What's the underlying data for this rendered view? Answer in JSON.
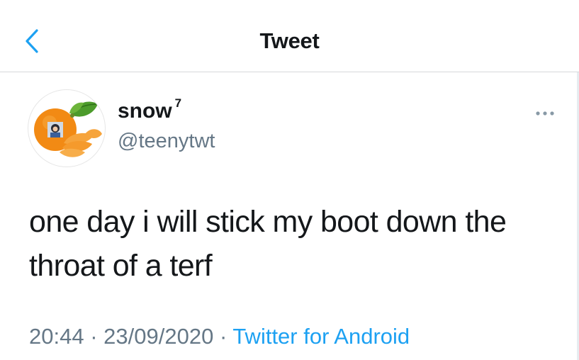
{
  "header": {
    "title": "Tweet",
    "back_icon": "chevron-left-icon",
    "accent_color": "#1da1f2"
  },
  "tweet": {
    "display_name": "snow",
    "name_badge": "7",
    "handle": "@teenytwt",
    "avatar_icon": "tangerine-avatar",
    "more_icon": "more-dots-icon",
    "text": "one day i will stick my boot down the throat of a terf",
    "time": "20:44",
    "separator": "·",
    "date": "23/09/2020",
    "source": "Twitter for Android"
  },
  "colors": {
    "text": "#14171a",
    "secondary": "#657786",
    "divider": "#d6d9db"
  }
}
